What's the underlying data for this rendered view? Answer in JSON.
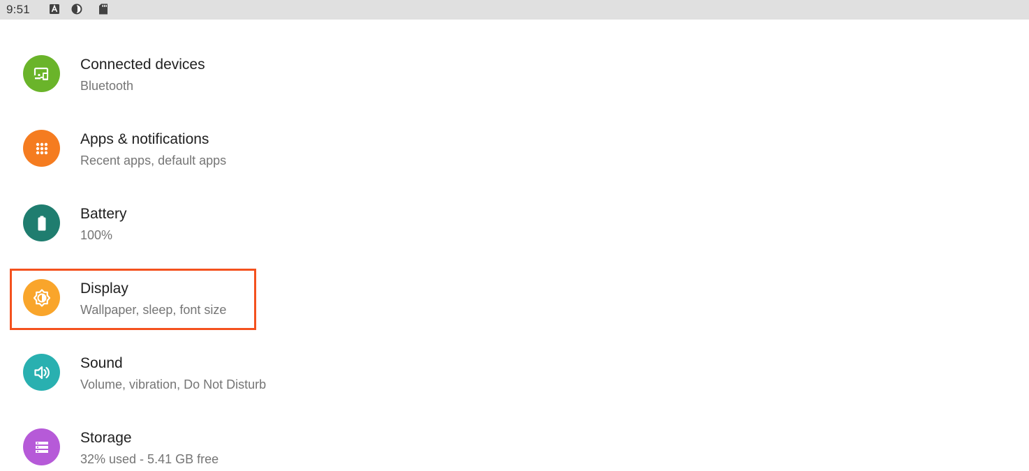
{
  "status_bar": {
    "time": "9:51",
    "icons": [
      "font-a-icon",
      "data-saver-icon",
      "sd-card-icon"
    ]
  },
  "settings": {
    "items": [
      {
        "title": "Connected devices",
        "subtitle": "Bluetooth",
        "icon": "devices-icon",
        "color": "#6ab42a"
      },
      {
        "title": "Apps & notifications",
        "subtitle": "Recent apps, default apps",
        "icon": "apps-grid-icon",
        "color": "#f57c20"
      },
      {
        "title": "Battery",
        "subtitle": "100%",
        "icon": "battery-icon",
        "color": "#1f7d6f"
      },
      {
        "title": "Display",
        "subtitle": "Wallpaper, sleep, font size",
        "icon": "brightness-icon",
        "color": "#f9a52b"
      },
      {
        "title": "Sound",
        "subtitle": "Volume, vibration, Do Not Disturb",
        "icon": "volume-icon",
        "color": "#29b0b0"
      },
      {
        "title": "Storage",
        "subtitle": "32% used - 5.41 GB free",
        "icon": "storage-icon",
        "color": "#b65ad8"
      }
    ]
  },
  "highlight": {
    "target": "Display",
    "color": "#f4511e"
  }
}
